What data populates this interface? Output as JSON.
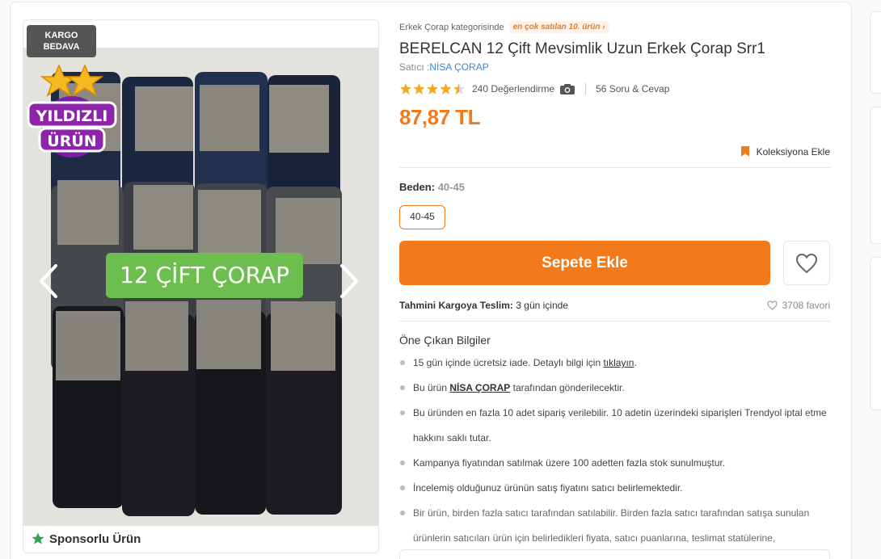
{
  "gallery": {
    "cargo_badge": "KARGO BEDAVA",
    "star_badge_line1": "YILDIZLI",
    "star_badge_line2": "ÜRÜN",
    "overlay_label": "12 ÇİFT ÇORAP",
    "sponsored_label": "Sponsorlu Ürün",
    "prev_icon": "chevron-left-icon",
    "next_icon": "chevron-right-icon",
    "sponsor_icon_color": "#2ea44f"
  },
  "product": {
    "category_text": "Erkek Çorap kategorisinde",
    "best_seller_badge": "en çok satılan 10. ürün",
    "title": "BERELCAN 12 Çift Mevsimlik Uzun Erkek Çorap Srr1",
    "seller_prefix": "Satıcı :",
    "seller_name": "NİSA ÇORAP",
    "rating_stars": 4.5,
    "rating_count": "240 Değerlendirme",
    "qa_count": "56 Soru & Cevap",
    "price": "87,87 TL",
    "collection_label": "Koleksiyona Ekle",
    "size_label": "Beden:",
    "size_value": "40-45",
    "size_option": "40-45",
    "add_to_cart": "Sepete Ekle",
    "delivery_label": "Tahmini Kargoya Teslim:",
    "delivery_value": "3 gün içinde",
    "favorite_count": "3708 favori"
  },
  "highlights": {
    "title": "Öne Çıkan Bilgiler",
    "b1_text": "15 gün içinde ücretsiz iade. Detaylı bilgi için",
    "b1_link": "tıklayın",
    "b1_end": ".",
    "b2_pre": "Bu ürün",
    "b2_seller": "NİSA ÇORAP",
    "b2_post": "tarafından gönderilecektir.",
    "b3": "Bu üründen en fazla 10 adet sipariş verilebilir. 10 adetin üzerindeki siparişleri Trendyol iptal etme hakkını saklı tutar.",
    "b4": "Kampanya fiyatından satılmak üzere 100 adetten fazla stok sunulmuştur.",
    "b5": "İncelemiş olduğunuz ürünün satış fiyatını satıcı belirlemektedir.",
    "b6": "Bir ürün, birden fazla satıcı tarafından satılabilir. Birden fazla satıcı tarafından satışa sunulan ürünlerin satıcıları ürün için belirledikleri fiyata, satıcı puanlarına, teslimat statülerine,"
  },
  "colors": {
    "accent": "#f27a1a",
    "link": "#3a86d3",
    "star": "#f5a623"
  }
}
